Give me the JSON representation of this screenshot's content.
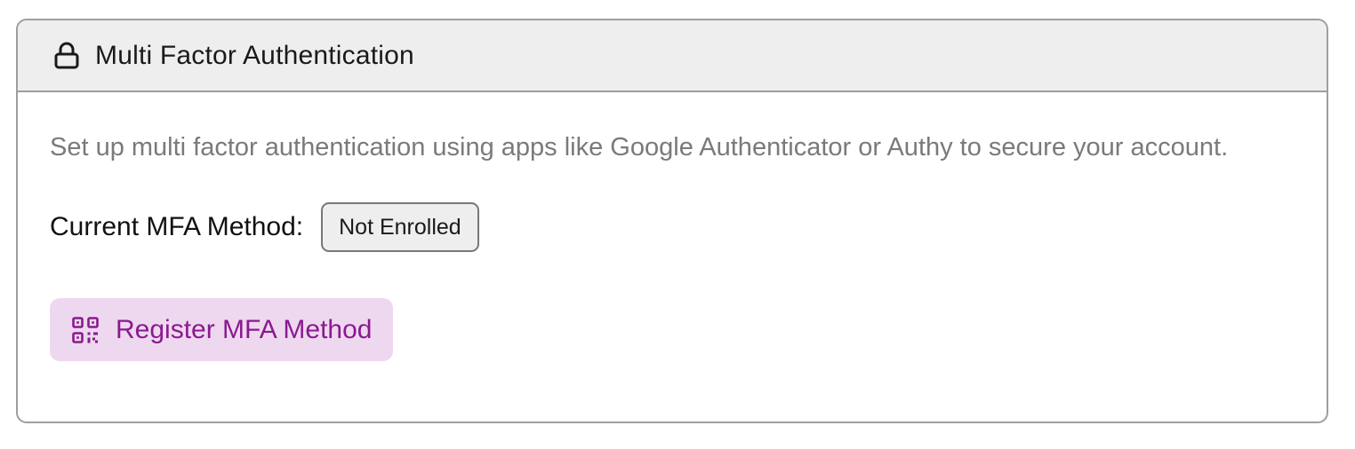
{
  "card": {
    "title": "Multi Factor Authentication",
    "header_icon": "lock-icon",
    "description": "Set up multi factor authentication using apps like Google Authenticator or Authy to secure your account.",
    "method_label": "Current MFA Method:",
    "method_status": "Not Enrolled",
    "register_button": {
      "label": "Register MFA Method",
      "icon": "qr-code-icon"
    }
  },
  "colors": {
    "header_bg": "#eeeeee",
    "border": "#9e9e9e",
    "description_text": "#7a7a7a",
    "button_bg": "#eed8ef",
    "button_text": "#8a1a8f"
  }
}
